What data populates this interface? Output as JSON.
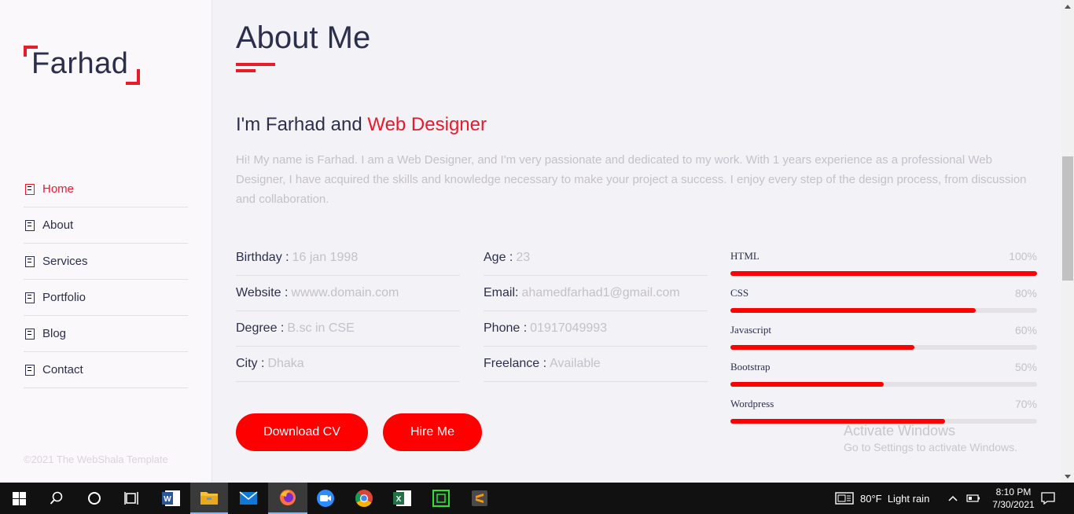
{
  "logo": {
    "text": "Farhad"
  },
  "nav": {
    "items": [
      {
        "label": "Home",
        "active": true
      },
      {
        "label": "About",
        "active": false
      },
      {
        "label": "Services",
        "active": false
      },
      {
        "label": "Portfolio",
        "active": false
      },
      {
        "label": "Blog",
        "active": false
      },
      {
        "label": "Contact",
        "active": false
      }
    ]
  },
  "footer": {
    "copyright": "©2021 The WebShala Template"
  },
  "about": {
    "title": "About Me",
    "heading_prefix": "I'm Farhad and",
    "heading_accent": "Web Designer",
    "intro": "Hi! My name is Farhad. I am a Web Designer, and I'm very passionate and dedicated to my work. With 1 years experience as a professional Web Designer, I have acquired the skills and knowledge necessary to make your project a success. I enjoy every step of the design process, from discussion and collaboration.",
    "info_left": [
      {
        "label": "Birthday :",
        "value": "16 jan 1998"
      },
      {
        "label": "Website :",
        "value": "wwww.domain.com"
      },
      {
        "label": "Degree :",
        "value": "B.sc in CSE"
      },
      {
        "label": "City :",
        "value": "Dhaka"
      }
    ],
    "info_right": [
      {
        "label": "Age :",
        "value": "23"
      },
      {
        "label": "Email:",
        "value": "ahamedfarhad1@gmail.com"
      },
      {
        "label": "Phone :",
        "value": "01917049993"
      },
      {
        "label": "Freelance :",
        "value": "Available"
      }
    ],
    "skills": [
      {
        "name": "HTML",
        "percent_label": "100%",
        "level": 1.0
      },
      {
        "name": "CSS",
        "percent_label": "80%",
        "level": 0.8
      },
      {
        "name": "Javascript",
        "percent_label": "60%",
        "level": 0.6
      },
      {
        "name": "Bootstrap",
        "percent_label": "50%",
        "level": 0.5
      },
      {
        "name": "Wordpress",
        "percent_label": "70%",
        "level": 0.7
      }
    ],
    "buttons": {
      "download_cv": "Download CV",
      "hire_me": "Hire Me"
    }
  },
  "watermark": {
    "line1": "Activate Windows",
    "line2": "Go to Settings to activate Windows."
  },
  "taskbar": {
    "apps": [
      "start-icon",
      "search-icon",
      "cortana-icon",
      "task-view-icon",
      "word-icon",
      "file-explorer-icon",
      "mail-icon",
      "firefox-icon",
      "zoom-icon",
      "chrome-icon",
      "excel-icon",
      "terminal-icon",
      "sublime-icon"
    ],
    "weather": "80°F  Light rain",
    "time": "8:10 PM",
    "date": "7/30/2021"
  },
  "colors": {
    "accent": "#e81b2b",
    "button": "#ff0000",
    "text_dark": "#2b2f4c",
    "text_muted": "#c5c0ca"
  }
}
